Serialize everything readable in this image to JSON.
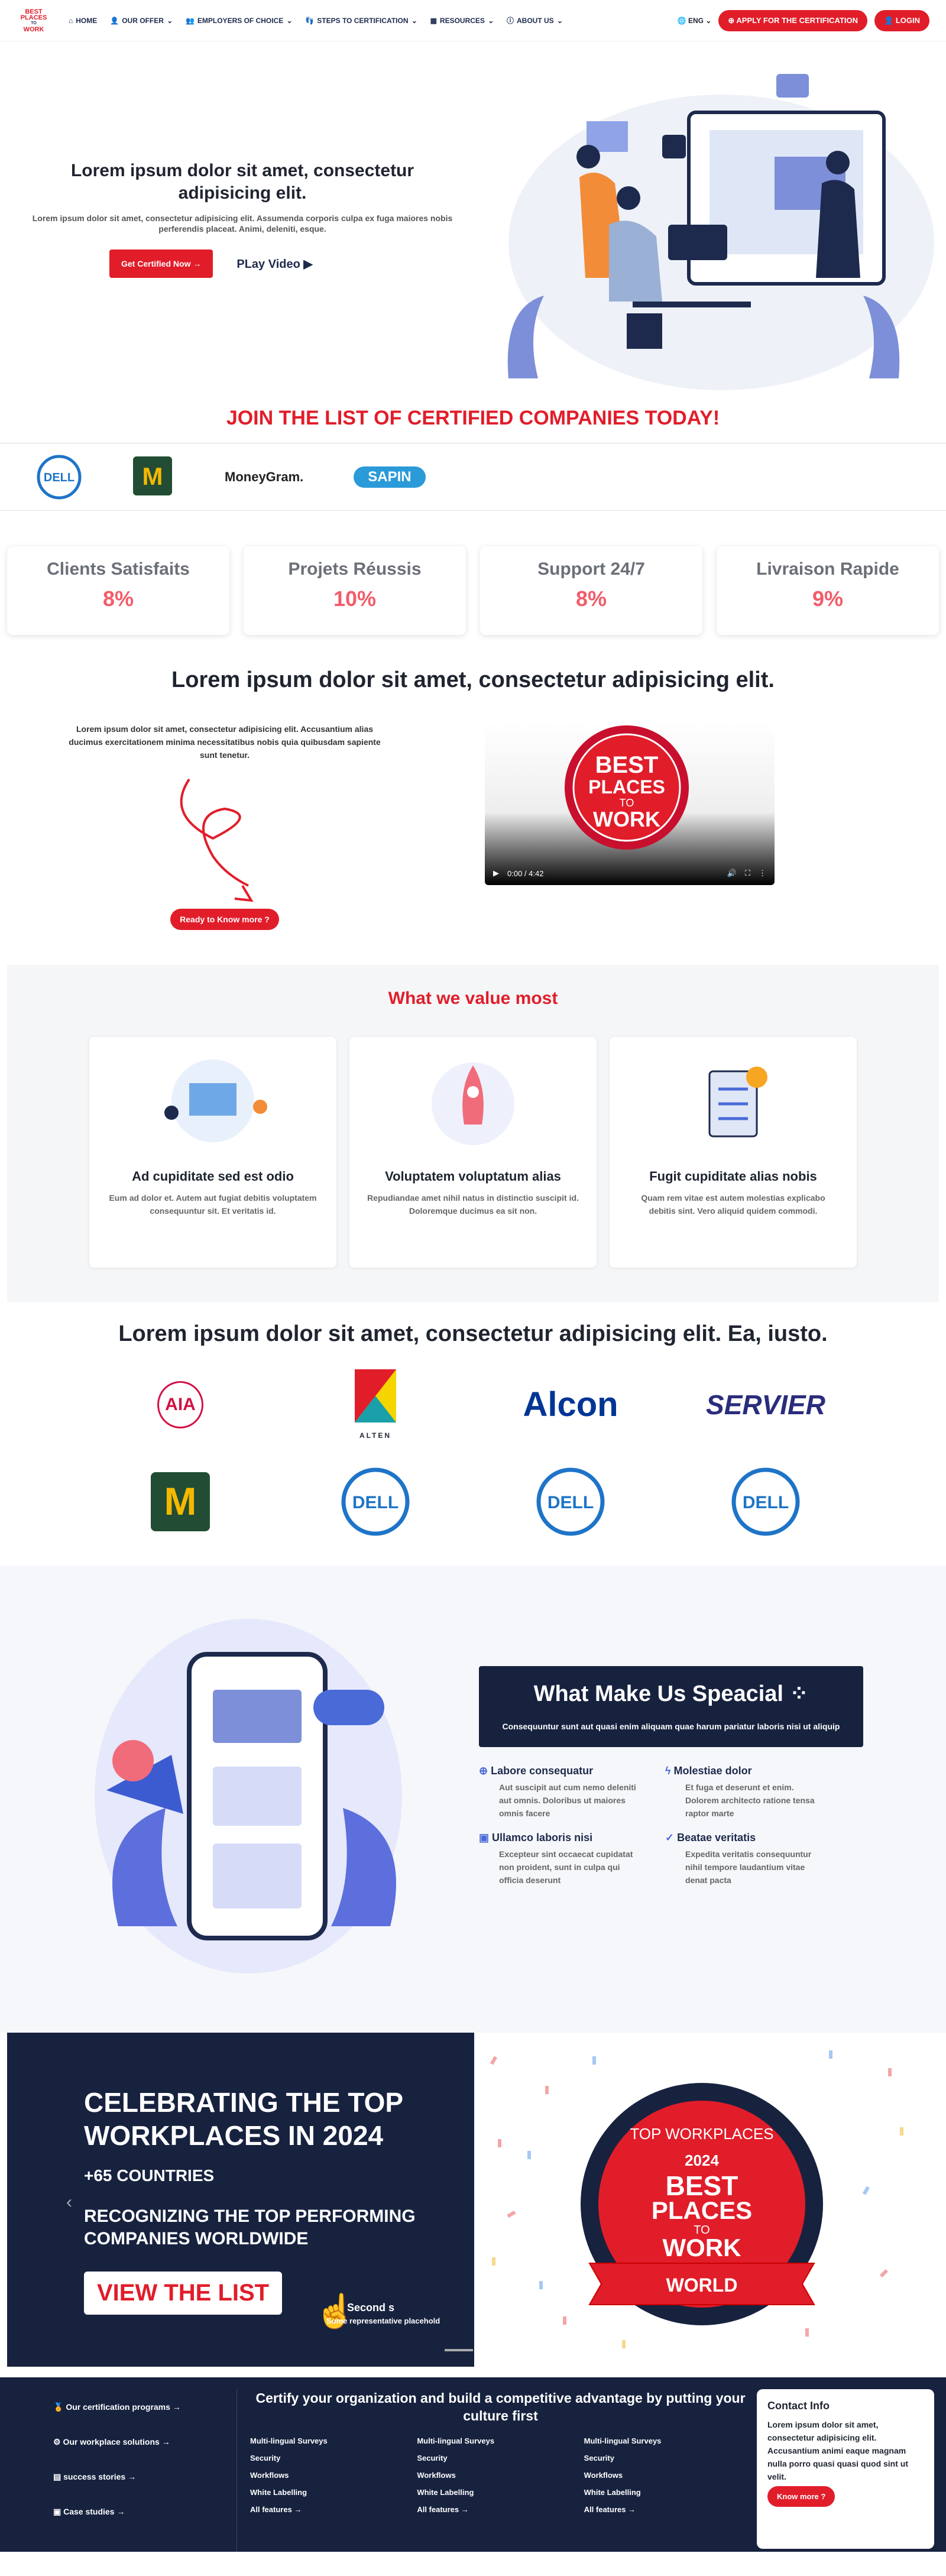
{
  "nav": {
    "logo_lines": [
      "BEST",
      "PLACES",
      "TO",
      "WORK"
    ],
    "items": [
      "HOME",
      "OUR OFFER",
      "EMPLOYERS OF CHOICE",
      "STEPS TO CERTIFICATION",
      "RESOURCES",
      "ABOUT US"
    ],
    "lang": "ENG",
    "apply": "APPLY FOR THE CERTIFICATION",
    "login": "LOGIN"
  },
  "hero": {
    "title": "Lorem ipsum dolor sit amet, consectetur adipisicing elit.",
    "text": "Lorem ipsum dolor sit amet, consectetur adipisicing elit. Assumenda corporis culpa ex fuga maiores nobis perferendis placeat. Animi, deleniti, esque.",
    "cta": "Get Certified Now",
    "play": "PLay Video"
  },
  "join": "JOIN THE LIST OF CERTIFIED COMPANIES TODAY!",
  "strip": [
    "DELL",
    "McDonald's",
    "MoneyGram.",
    "SAPIN"
  ],
  "stats": [
    {
      "label": "Clients Satisfaits",
      "value": "8%"
    },
    {
      "label": "Projets Réussis",
      "value": "10%"
    },
    {
      "label": "Support 24/7",
      "value": "8%"
    },
    {
      "label": "Livraison Rapide",
      "value": "9%"
    }
  ],
  "intro": {
    "title": "Lorem ipsum dolor sit amet, consectetur adipisicing elit.",
    "text": "Lorem ipsum dolor sit amet, consectetur adipisicing elit. Accusantium alias ducimus exercitationem minima necessitatibus nobis quia quibusdam sapiente sunt tenetur.",
    "cta": "Ready to Know more ?",
    "video_time": "0:00 / 4:42"
  },
  "values": {
    "title": "What we value most",
    "cards": [
      {
        "title": "Ad cupiditate sed est odio",
        "text": "Eum ad dolor et. Autem aut fugiat debitis voluptatem consequuntur sit. Et veritatis id."
      },
      {
        "title": "Voluptatem voluptatum alias",
        "text": "Repudiandae amet nihil natus in distinctio suscipit id. Doloremque ducimus ea sit non."
      },
      {
        "title": "Fugit cupiditate alias nobis",
        "text": "Quam rem vitae est autem molestias explicabo debitis sint. Vero aliquid quidem commodi."
      }
    ]
  },
  "clients": {
    "title": "Lorem ipsum dolor sit amet, consectetur adipisicing elit. Ea, iusto.",
    "names": [
      "AIA",
      "ALTEN",
      "Alcon",
      "SERVIER",
      "McDonald's",
      "DELL",
      "DELL",
      "DELL"
    ]
  },
  "special": {
    "title": "What Make Us Speacial",
    "text": "Consequuntur sunt aut quasi enim aliquam quae harum pariatur laboris nisi ut aliquip",
    "features": [
      {
        "title": "Labore consequatur",
        "text": "Aut suscipit aut cum nemo deleniti aut omnis. Doloribus ut maiores omnis facere"
      },
      {
        "title": "Molestiae dolor",
        "text": "Et fuga et deserunt et enim. Dolorem architecto ratione tensa raptor marte"
      },
      {
        "title": "Ullamco laboris nisi",
        "text": "Excepteur sint occaecat cupidatat non proident, sunt in culpa qui officia deserunt"
      },
      {
        "title": "Beatae veritatis",
        "text": "Expedita veritatis consequuntur nihil tempore laudantium vitae denat pacta"
      }
    ]
  },
  "celebrate": {
    "title": "CELEBRATING THE TOP WORKPLACES IN 2024",
    "countries": "+65 COUNTRIES",
    "recognize": "RECOGNIZING THE TOP PERFORMING COMPANIES WORLDWIDE",
    "cta": "VIEW THE LIST",
    "second": "Second s",
    "second_sub": "Some representative placehold",
    "badge_top": "TOP WORKPLACES",
    "badge_year": "2024",
    "badge_world": "WORLD"
  },
  "footer": {
    "links": [
      "Our certification programs",
      "Our workplace solutions",
      "success stories",
      "Case studies"
    ],
    "title": "Certify your organization and build a competitive advantage by putting your culture first",
    "cols": [
      [
        "Multi-lingual Surveys",
        "Security",
        "Workflows",
        "White Labelling",
        "All features"
      ],
      [
        "Multi-lingual Surveys",
        "Security",
        "Workflows",
        "White Labelling",
        "All features"
      ],
      [
        "Multi-lingual Surveys",
        "Security",
        "Workflows",
        "White Labelling",
        "All features"
      ]
    ],
    "contact_title": "Contact Info",
    "contact_text": "Lorem ipsum dolor sit amet, consectetur adipisicing elit. Accusantium animi eaque magnam nulla porro quasi quasi quod sint ut velit.",
    "contact_cta": "Know more ?"
  }
}
